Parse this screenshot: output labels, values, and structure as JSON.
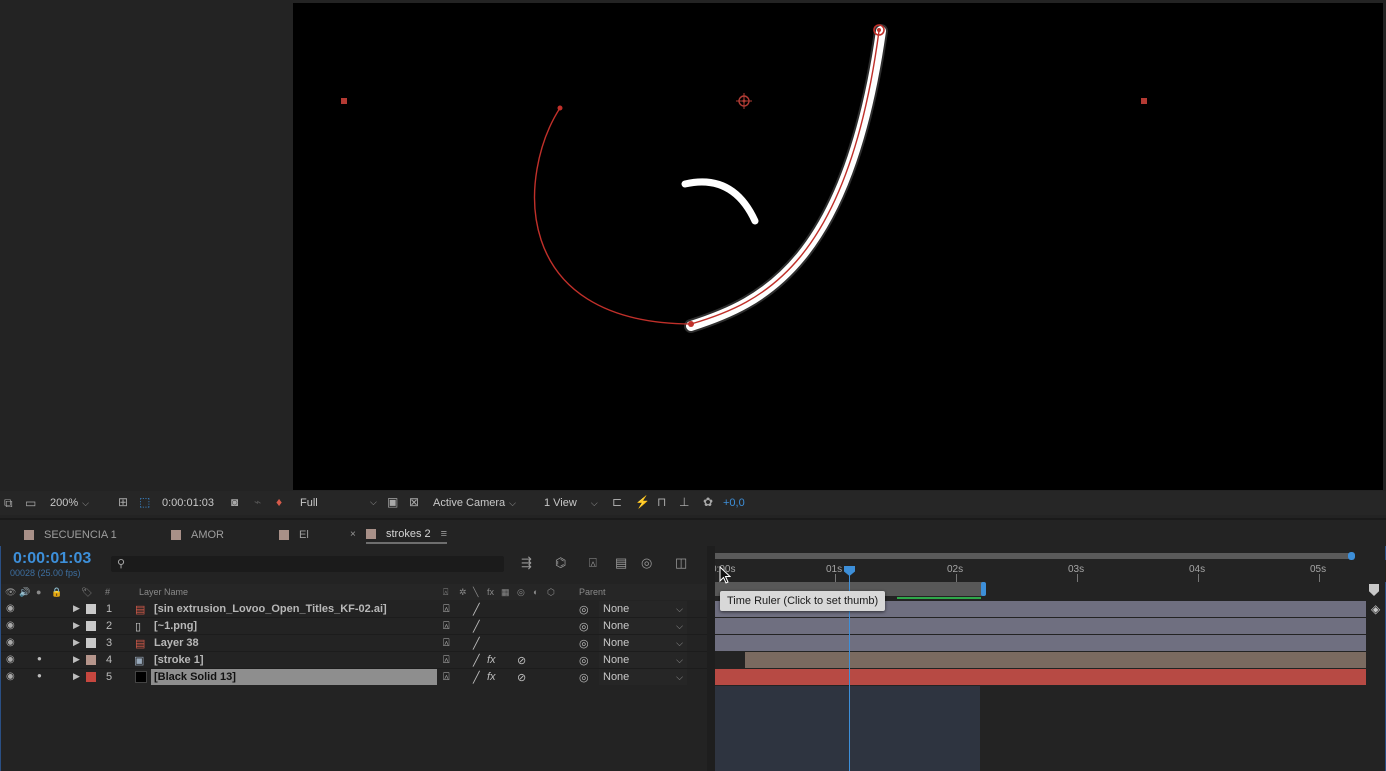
{
  "viewer_toolbar": {
    "zoom": "200%",
    "timecode": "0:00:01:03",
    "resolution": "Full",
    "camera": "Active Camera",
    "views": "1 View",
    "exposure": "+0,0"
  },
  "tabs": [
    {
      "label": "SECUENCIA 1",
      "active": false
    },
    {
      "label": "AMOR",
      "active": false
    },
    {
      "label": "El",
      "active": false
    },
    {
      "label": "strokes 2",
      "active": true
    }
  ],
  "timeline": {
    "timecode": "0:00:01:03",
    "frame_info": "00028 (25.00 fps)",
    "column_headers": {
      "hash": "#",
      "layer_name": "Layer Name",
      "parent": "Parent"
    },
    "ruler_labels": [
      "0:00s",
      "01s",
      "02s",
      "03s",
      "04s",
      "05s"
    ],
    "tooltip": "Time Ruler (Click to set thumb)"
  },
  "layers": [
    {
      "num": "1",
      "name": "[sin extrusion_Lovoo_Open_Titles_KF-02.ai]",
      "parent": "None",
      "label_color": "#c9c9c9",
      "selected": false
    },
    {
      "num": "2",
      "name": "[~1.png]",
      "parent": "None",
      "label_color": "#c9c9c9",
      "selected": false
    },
    {
      "num": "3",
      "name": "Layer 38",
      "parent": "None",
      "label_color": "#c9c9c9",
      "selected": false
    },
    {
      "num": "4",
      "name": "[stroke 1]",
      "parent": "None",
      "label_color": "#b5958b",
      "selected": false
    },
    {
      "num": "5",
      "name": "[Black Solid 13]",
      "parent": "None",
      "label_color": "#c6473f",
      "selected": true
    }
  ],
  "colors": {
    "accent": "#3d8fd9",
    "path_red": "#c0302a",
    "solid_bar": "#b74a44",
    "bar_gray": "#6f6f80"
  }
}
